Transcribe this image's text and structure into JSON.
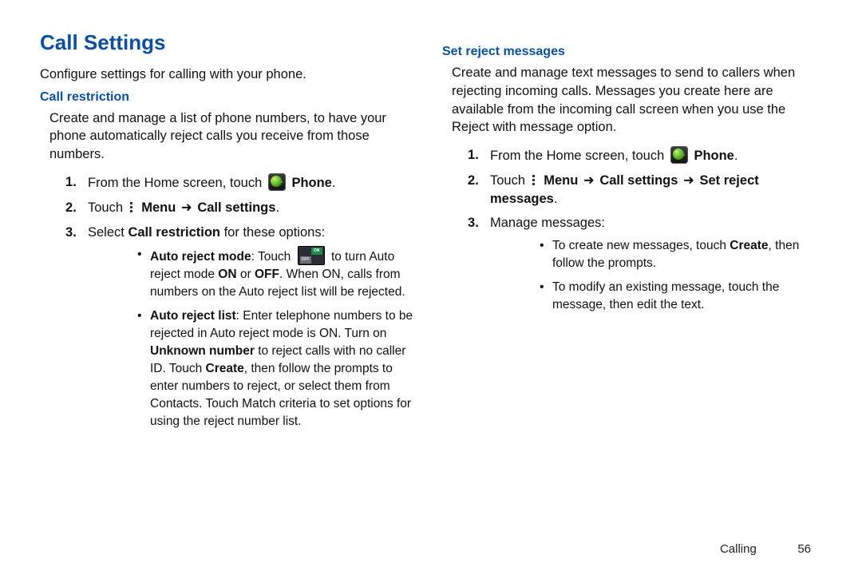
{
  "page": {
    "section": "Calling",
    "number": "56"
  },
  "h1": "Call Settings",
  "intro": "Configure settings for calling with your phone.",
  "arrow": "➜",
  "left": {
    "subhead": "Call restriction",
    "para": "Create and manage a list of phone numbers, to have your phone automatically reject calls you receive from those numbers.",
    "step1_a": "From the Home screen, touch ",
    "step1_b": "Phone",
    "step1_c": ".",
    "step2_a": "Touch ",
    "step2_b": "Menu",
    "step2_c": "Call settings",
    "step2_d": ".",
    "step3_a": "Select ",
    "step3_b": "Call restriction",
    "step3_c": " for these options:",
    "b1_a": "Auto reject mode",
    "b1_b": ": Touch ",
    "b1_c": " to turn Auto reject mode ",
    "b1_d": "ON",
    "b1_e": " or ",
    "b1_f": "OFF",
    "b1_g": ". When ON, calls from numbers on the Auto reject list will be rejected.",
    "b2_a": "Auto reject list",
    "b2_b": ": Enter telephone numbers to be rejected in Auto reject mode is ON. Turn on ",
    "b2_c": "Unknown number",
    "b2_d": " to reject calls with no caller ID. Touch ",
    "b2_e": "Create",
    "b2_f": ", then follow the prompts to enter numbers to reject, or select them from Contacts. Touch Match criteria to set options for using the reject number list."
  },
  "right": {
    "subhead": "Set reject messages",
    "para": "Create and manage text messages to send to callers when rejecting incoming calls. Messages you create here are available from the incoming call screen when you use the Reject with message option.",
    "step1_a": "From the Home screen, touch ",
    "step1_b": "Phone",
    "step1_c": ".",
    "step2_a": "Touch ",
    "step2_b": "Menu",
    "step2_c": "Call settings",
    "step2_d": "Set reject messages",
    "step2_e": ".",
    "step3": "Manage messages:",
    "b1_a": "To create new messages, touch ",
    "b1_b": "Create",
    "b1_c": ", then follow the prompts.",
    "b2": "To modify an existing message, touch the message, then edit the text."
  },
  "toggle": {
    "on": "ON",
    "off": "OFF"
  }
}
